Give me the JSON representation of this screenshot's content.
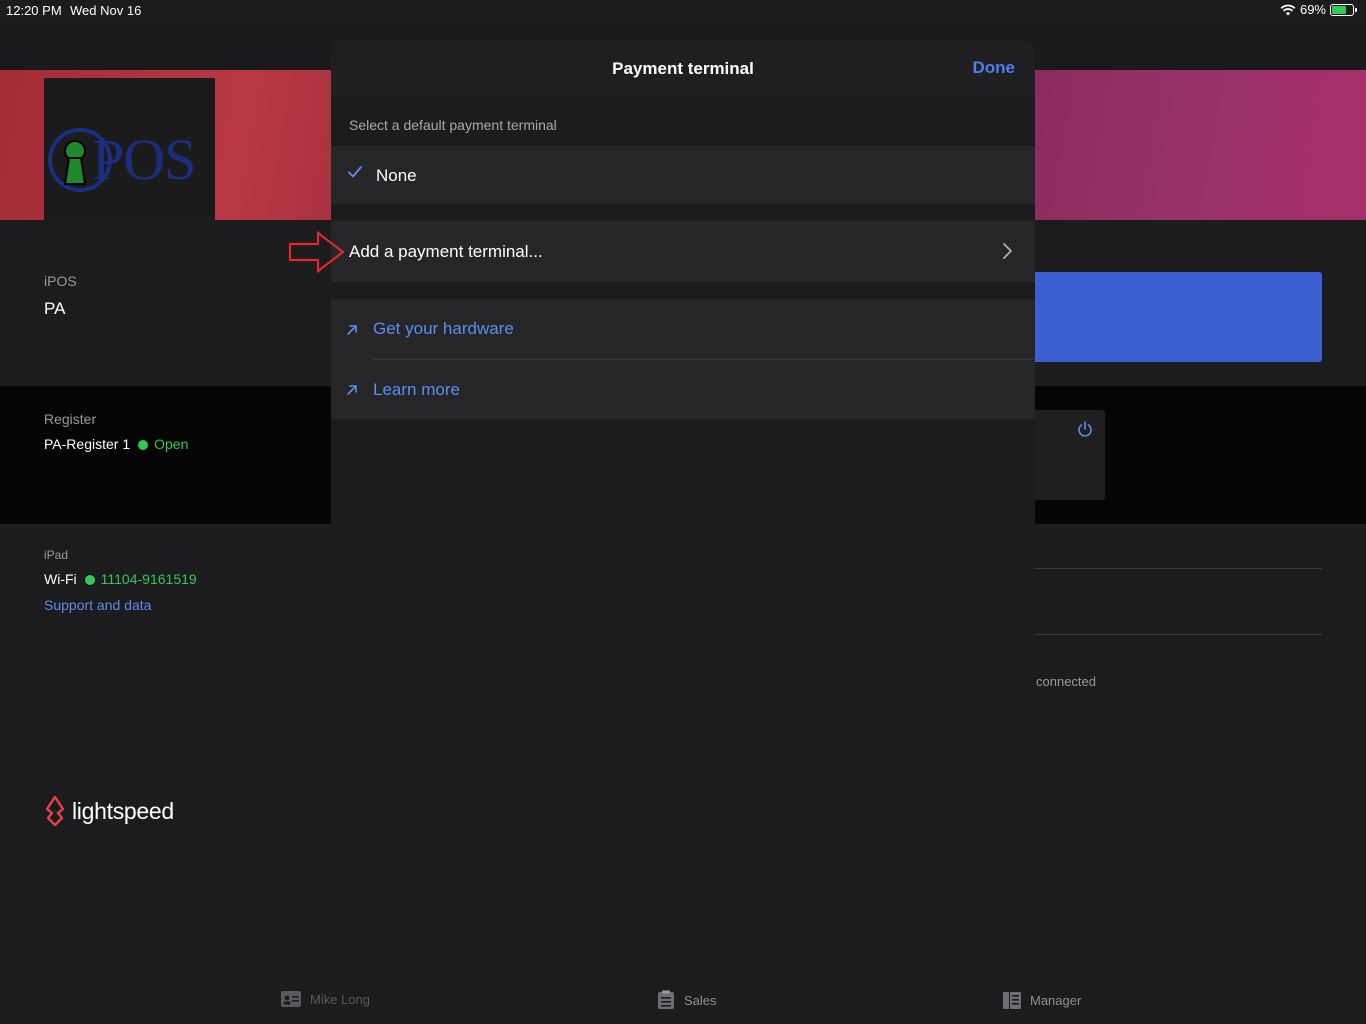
{
  "status_bar": {
    "time": "12:20 PM",
    "date": "Wed Nov 16",
    "battery": "69%",
    "battery_level": 0.69
  },
  "store": {
    "name_label": "iPOS",
    "name_value": "PA"
  },
  "register": {
    "label": "Register",
    "name": "PA-Register 1",
    "status": "Open"
  },
  "ipad": {
    "label": "iPad",
    "wifi_label": "Wi-Fi",
    "wifi_network": "11104-9161519",
    "support_link": "Support and data"
  },
  "background_right": {
    "connected_text": "connected"
  },
  "brand": {
    "wordmark": "lightspeed",
    "logo_text": "POS",
    "accent_color": "#e2434b"
  },
  "tabbar": {
    "user": "Mike Long",
    "sales": "Sales",
    "manager": "Manager"
  },
  "modal": {
    "title": "Payment terminal",
    "done_label": "Done",
    "section_label": "Select a default payment terminal",
    "selected_option": "None",
    "add_terminal_label": "Add a payment terminal...",
    "links": [
      {
        "label": "Get your hardware"
      },
      {
        "label": "Learn more"
      }
    ]
  },
  "colors": {
    "link_blue": "#5b8def",
    "status_green": "#34c759",
    "annotation_red": "#e0262b"
  }
}
